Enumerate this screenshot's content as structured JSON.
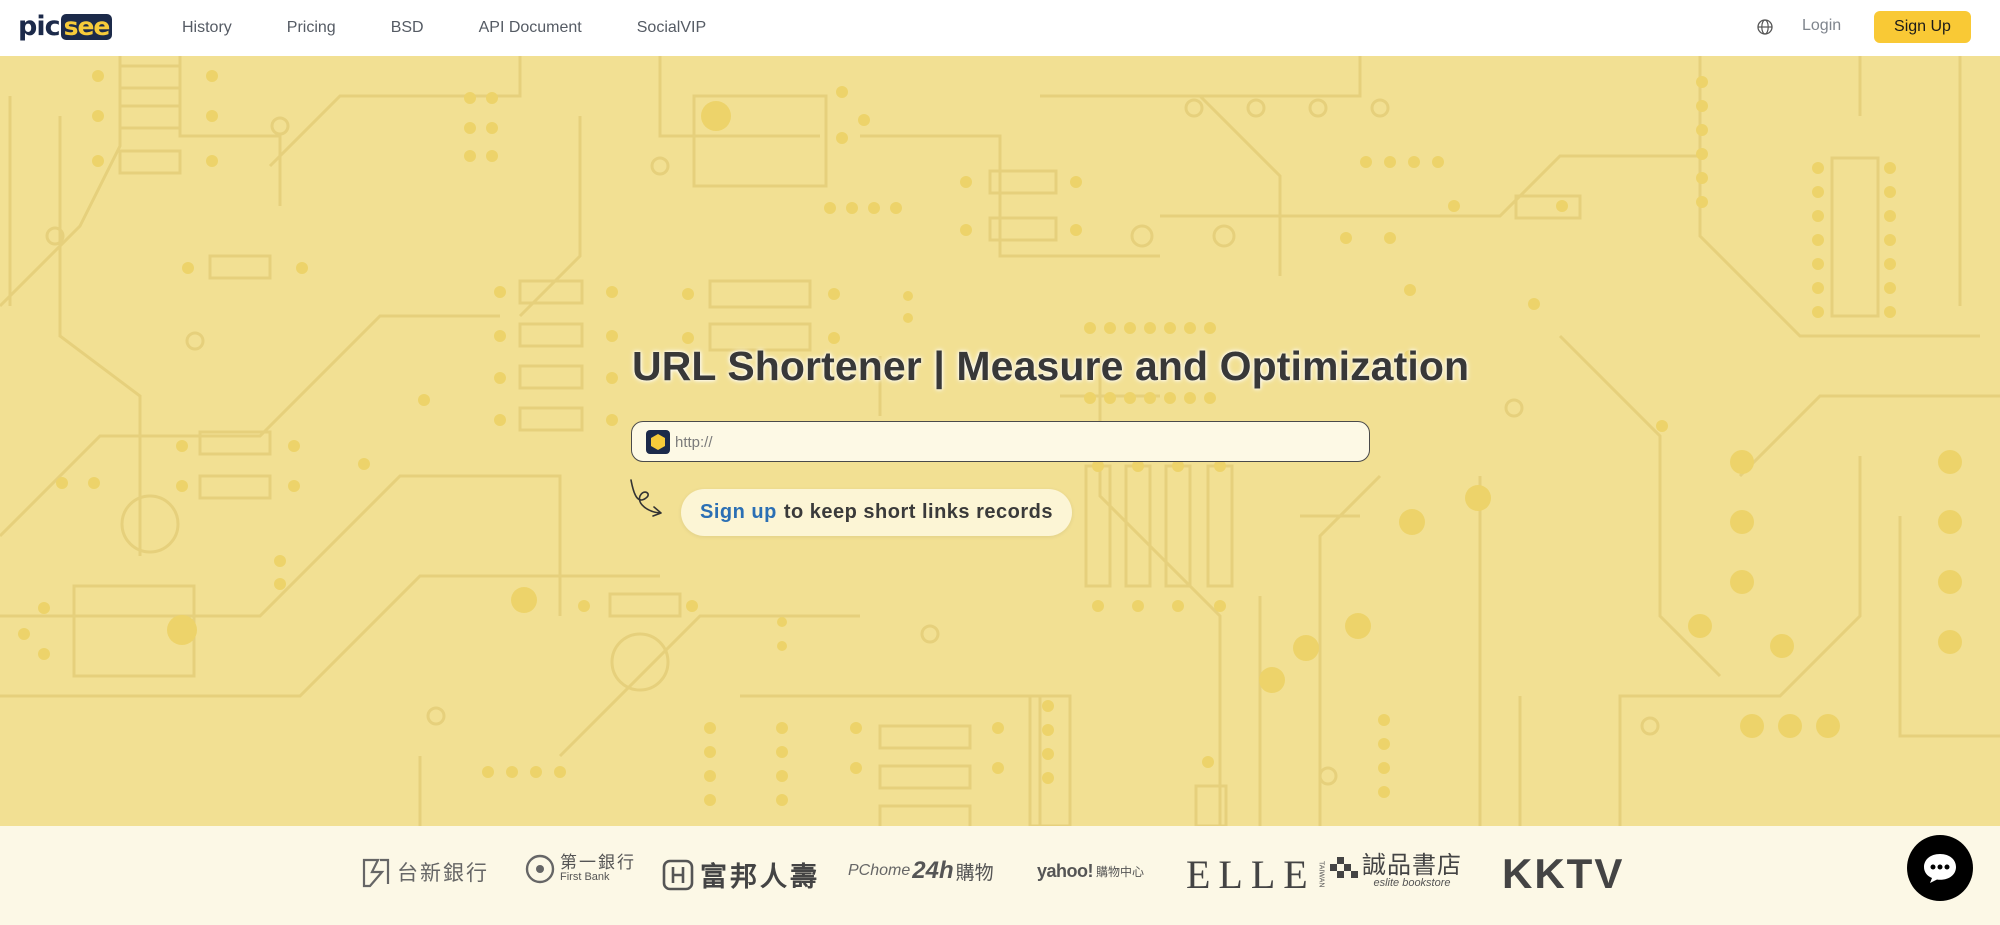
{
  "header": {
    "logo": {
      "part1": "pic",
      "part2": "see"
    },
    "nav": [
      {
        "id": "history",
        "label": "History"
      },
      {
        "id": "pricing",
        "label": "Pricing"
      },
      {
        "id": "bsd",
        "label": "BSD"
      },
      {
        "id": "api",
        "label": "API Document"
      },
      {
        "id": "socialvip",
        "label": "SocialVIP"
      }
    ],
    "login_label": "Login",
    "signup_label": "Sign Up"
  },
  "hero": {
    "title": "URL Shortener | Measure and Optimization",
    "url_placeholder": "http://",
    "hint_link": "Sign up",
    "hint_rest": "to keep short links records"
  },
  "partners": {
    "taishin": "台新銀行",
    "first_bank_zh": "第一銀行",
    "first_bank_en": "First Bank",
    "fubon": "富邦人壽",
    "pchome_a": "PChome",
    "pchome_b": "24h",
    "pchome_c": "購物",
    "yahoo_a": "yahoo!",
    "yahoo_b": "購物中心",
    "elle_a": "ELLE",
    "elle_b": "TAIWAN",
    "eslite_zh": "誠品書店",
    "eslite_en": "eslite bookstore",
    "kktv": "KKTV"
  },
  "colors": {
    "background": "#f2e093",
    "accent": "#f9c935",
    "brand_navy": "#1c2a4a",
    "link": "#2b6fb4"
  },
  "icons": {
    "globe": "globe-icon",
    "chat": "chat-bubble-icon",
    "url_logo": "picsee-hexagon-icon",
    "arrow": "curly-arrow-icon"
  }
}
